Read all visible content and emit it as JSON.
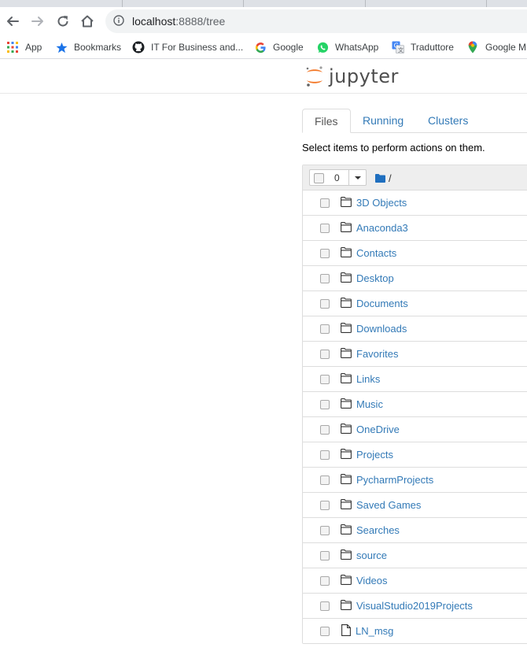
{
  "browser": {
    "url_host": "localhost",
    "url_path": ":8888/tree",
    "bookmarks": [
      {
        "label": "App",
        "icon": "apps-grid-icon"
      },
      {
        "label": "Bookmarks",
        "icon": "star-icon"
      },
      {
        "label": "IT For Business and...",
        "icon": "github-icon"
      },
      {
        "label": "Google",
        "icon": "google-icon"
      },
      {
        "label": "WhatsApp",
        "icon": "whatsapp-icon"
      },
      {
        "label": "Traduttore",
        "icon": "translate-icon"
      },
      {
        "label": "Google M",
        "icon": "maps-pin-icon"
      }
    ]
  },
  "jupyter": {
    "logo_text": "jupyter",
    "tabs": [
      {
        "label": "Files"
      },
      {
        "label": "Running"
      },
      {
        "label": "Clusters"
      }
    ],
    "hint": "Select items to perform actions on them.",
    "selected_count": "0",
    "breadcrumb": "/",
    "items": [
      {
        "name": "3D Objects",
        "type": "folder"
      },
      {
        "name": "Anaconda3",
        "type": "folder"
      },
      {
        "name": "Contacts",
        "type": "folder"
      },
      {
        "name": "Desktop",
        "type": "folder"
      },
      {
        "name": "Documents",
        "type": "folder"
      },
      {
        "name": "Downloads",
        "type": "folder"
      },
      {
        "name": "Favorites",
        "type": "folder"
      },
      {
        "name": "Links",
        "type": "folder"
      },
      {
        "name": "Music",
        "type": "folder"
      },
      {
        "name": "OneDrive",
        "type": "folder"
      },
      {
        "name": "Projects",
        "type": "folder"
      },
      {
        "name": "PycharmProjects",
        "type": "folder"
      },
      {
        "name": "Saved Games",
        "type": "folder"
      },
      {
        "name": "Searches",
        "type": "folder"
      },
      {
        "name": "source",
        "type": "folder"
      },
      {
        "name": "Videos",
        "type": "folder"
      },
      {
        "name": "VisualStudio2019Projects",
        "type": "folder"
      },
      {
        "name": "LN_msg",
        "type": "file"
      }
    ]
  },
  "colors": {
    "link": "#337ab7",
    "jupyter_orange": "#f37726",
    "folder_blue": "#1f6fbf"
  }
}
